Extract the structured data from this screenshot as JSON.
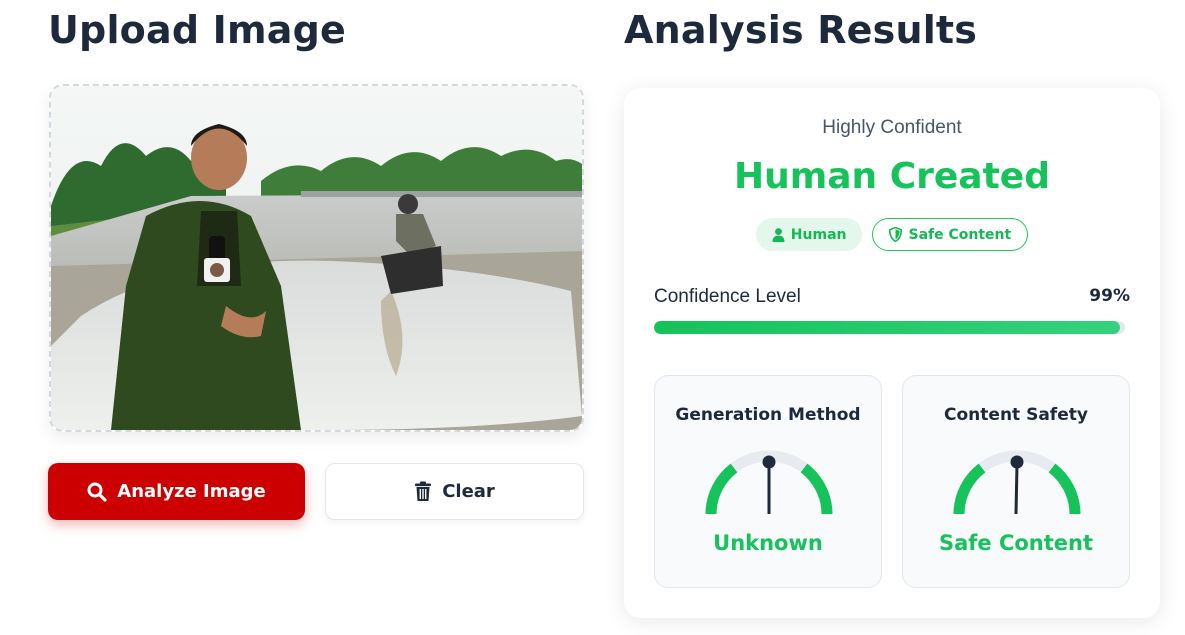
{
  "upload": {
    "heading": "Upload Image",
    "analyze_label": "Analyze Image",
    "clear_label": "Clear",
    "icons": {
      "analyze": "search-icon",
      "clear": "trash-icon"
    },
    "colors": {
      "analyze_bg": "#cc0000"
    }
  },
  "results": {
    "heading": "Analysis Results",
    "confidence_text": "Highly Confident",
    "verdict": "Human Created",
    "badges": [
      {
        "label": "Human",
        "icon": "user-icon"
      },
      {
        "label": "Safe Content",
        "icon": "shield-icon"
      }
    ],
    "meter": {
      "label": "Confidence Level",
      "value_text": "99%",
      "fill_percent": 99
    },
    "generation": {
      "title": "Generation Method",
      "value": "Unknown"
    },
    "safety": {
      "title": "Content Safety",
      "value": "Safe Content"
    },
    "colors": {
      "accent": "#16c25a",
      "text": "#1e293b"
    }
  }
}
